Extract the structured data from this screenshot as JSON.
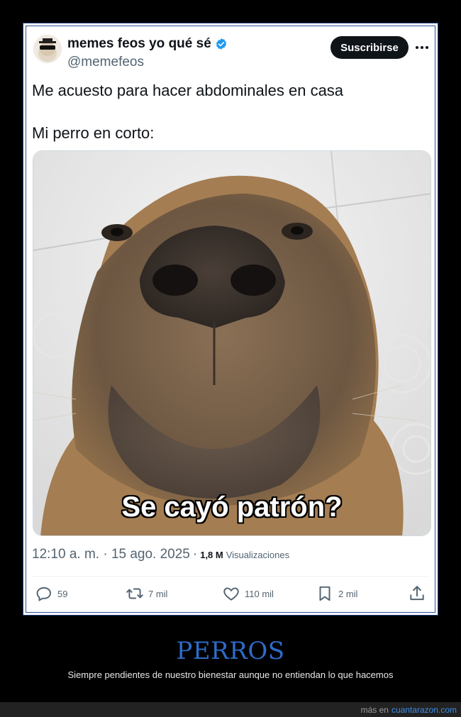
{
  "tweet": {
    "display_name": "memes feos yo qué sé",
    "handle": "@memefeos",
    "subscribe_label": "Suscribirse",
    "text_line_1": "Me acuesto para hacer abdominales en casa",
    "text_line_2": "Mi perro en corto:",
    "image_caption": "Se cayó patrón?",
    "time": "12:10 a. m. · 15 ago. 2025",
    "separator": "·",
    "views_count": "1,8 M",
    "views_label": "Visualizaciones",
    "actions": {
      "replies": "59",
      "retweets": "7 mil",
      "likes": "110 mil",
      "bookmarks": "2 mil"
    },
    "icons": [
      "verified-icon",
      "more-icon",
      "reply-icon",
      "retweet-icon",
      "like-icon",
      "bookmark-icon",
      "share-icon"
    ],
    "colors": {
      "verified": "#1d9bf0",
      "subscribe_bg": "#0f1419",
      "muted_text": "#536471"
    }
  },
  "footer": {
    "title": "PERROS",
    "subtitle": "Siempre pendientes de nuestro bienestar aunque no entiendan lo que hacemos",
    "source_prefix": "más en",
    "source_link": "cuantarazon.com",
    "colors": {
      "title": "#2d6cc9",
      "link": "#3d8ee8"
    }
  }
}
